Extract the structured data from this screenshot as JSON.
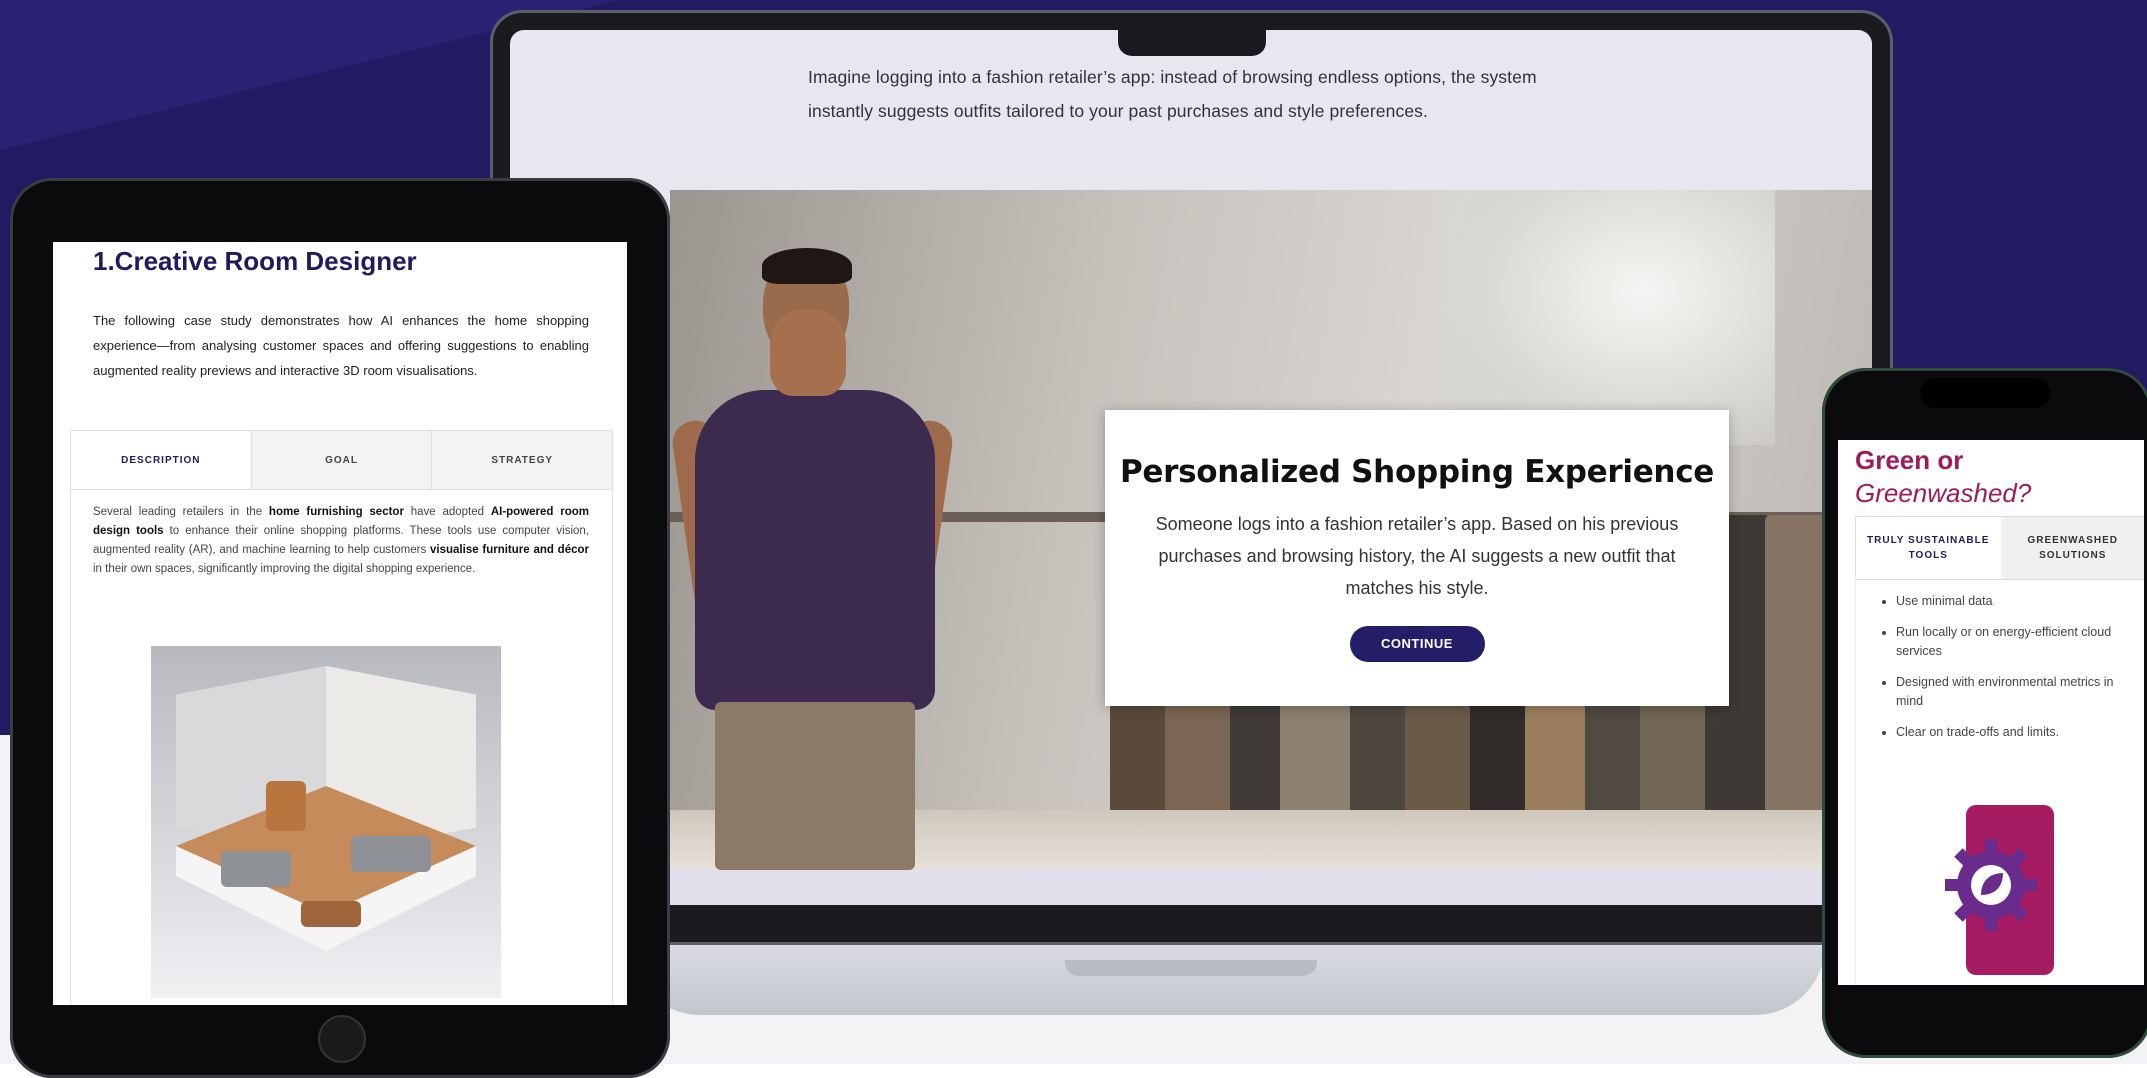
{
  "laptop": {
    "intro_text": "Imagine logging into a fashion retailer’s app: instead of browsing endless options, the system instantly suggests outfits tailored to your past purchases and style preferences.",
    "dialog": {
      "title": "Personalized Shopping Experience",
      "body": "Someone logs into a fashion retailer’s app. Based on his previous purchases and browsing history, the AI suggests a new outfit that matches his style.",
      "button": "CONTINUE"
    }
  },
  "tablet": {
    "title": "1.Creative Room Designer",
    "intro": "The following case study demonstrates how AI enhances the home shopping experience—from analysing customer spaces and offering  suggestions to enabling augmented reality previews and interactive 3D room visualisations.",
    "tabs": [
      "DESCRIPTION",
      "GOAL",
      "STRATEGY"
    ],
    "body": {
      "p1": "Several leading retailers in the ",
      "b1": "home furnishing sector",
      "p2": " have adopted ",
      "b2": "AI-powered room design tools",
      "p3": " to enhance their online shopping platforms. These tools use computer vision, augmented reality (AR), and machine learning to help customers ",
      "b3": "visualise furniture and décor",
      "p4": " in their own spaces, significantly improving the digital shopping experience."
    }
  },
  "phone": {
    "title_line1": "Green or",
    "title_line2": "Greenwashed?",
    "tabs": [
      "TRULY SUSTAINABLE TOOLS",
      "GREENWASHED SOLUTIONS"
    ],
    "list": [
      "Use minimal data",
      "Run locally or on energy-efficient cloud services",
      "Designed with environmental metrics in mind",
      "Clear on trade-offs and limits."
    ],
    "accent_color": "#a61c63"
  },
  "colors": {
    "background": "#221a63",
    "brand_navy": "#231a5d",
    "button": "#241e69"
  }
}
